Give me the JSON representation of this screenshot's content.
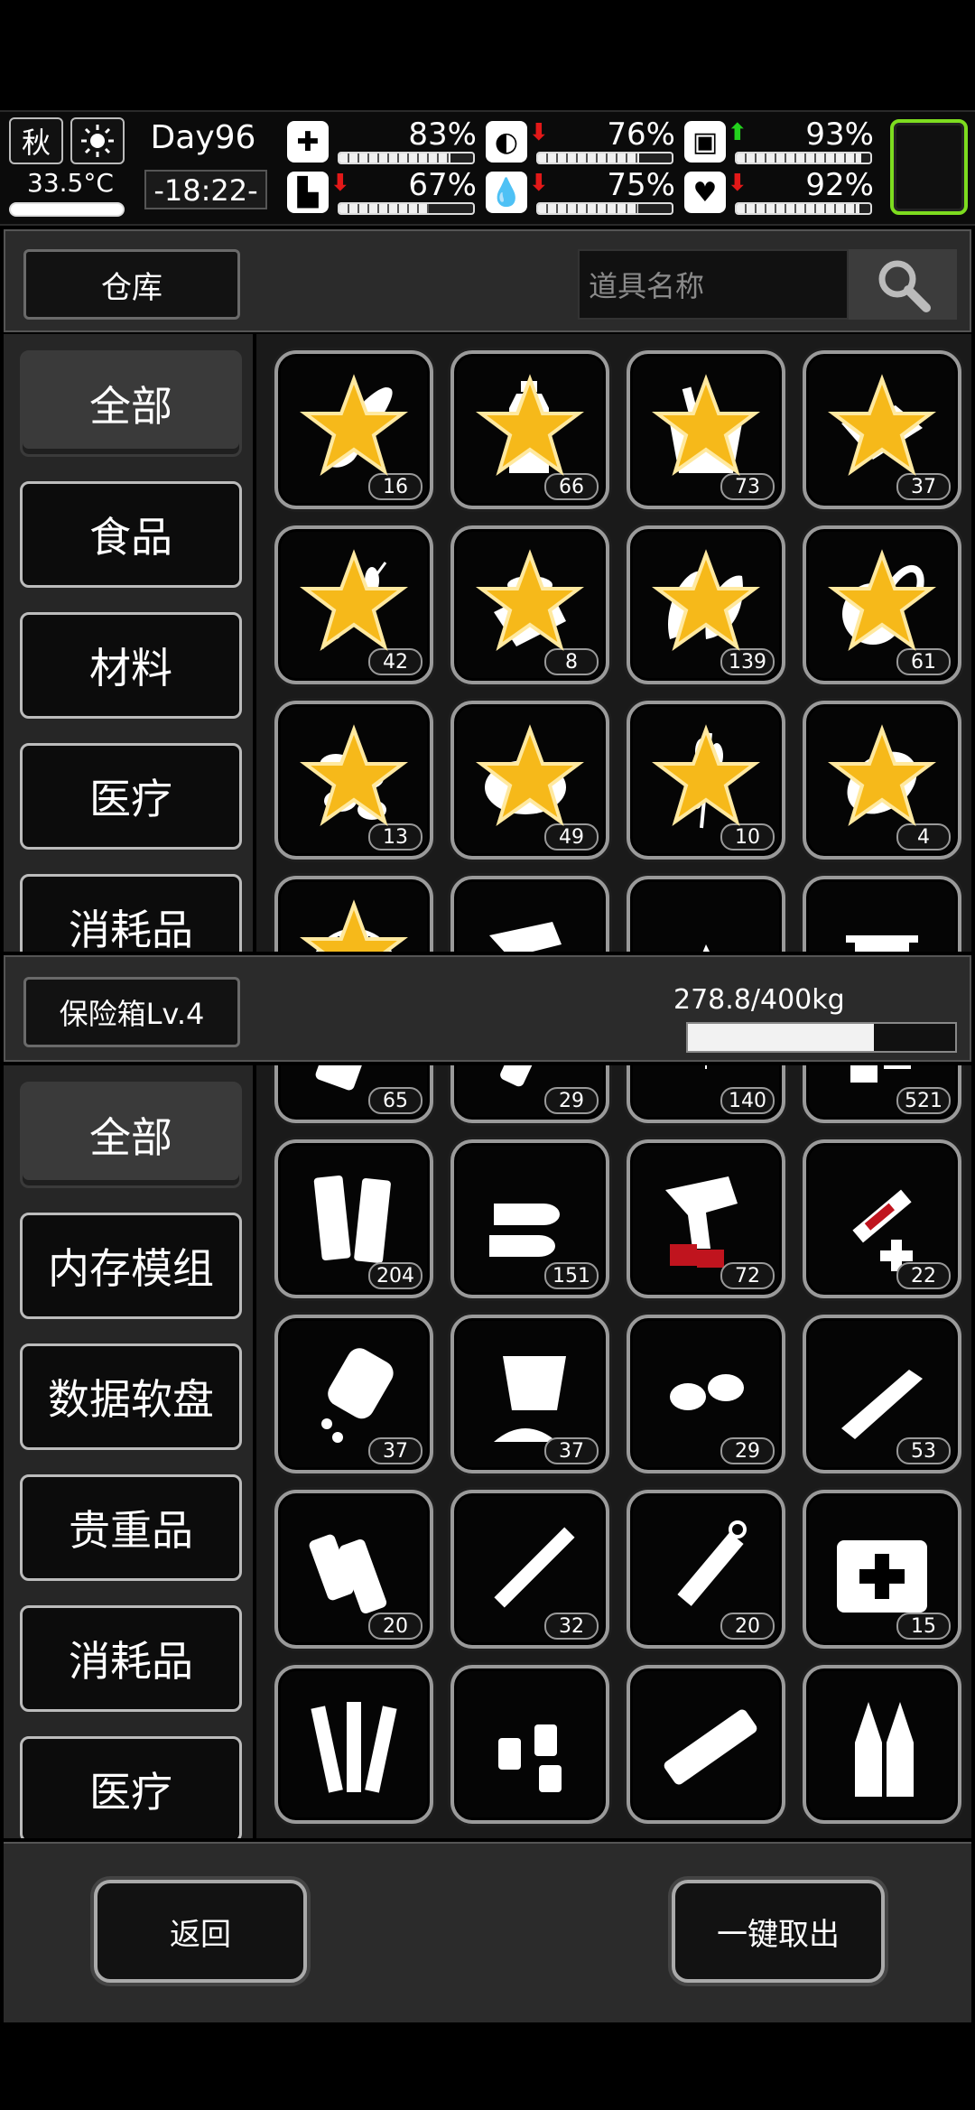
{
  "status": {
    "season": "秋",
    "temperature": "33.5°C",
    "day": "Day96",
    "time": "-18:22-",
    "stats": [
      {
        "name": "health",
        "percent": "83%",
        "fill": 0.83,
        "arrow": ""
      },
      {
        "name": "hunger",
        "percent": "76%",
        "fill": 0.76,
        "arrow": "down"
      },
      {
        "name": "stamina",
        "percent": "93%",
        "fill": 0.93,
        "arrow": "up"
      },
      {
        "name": "legs",
        "percent": "67%",
        "fill": 0.67,
        "arrow": "down"
      },
      {
        "name": "thirst",
        "percent": "75%",
        "fill": 0.75,
        "arrow": "down"
      },
      {
        "name": "mood",
        "percent": "92%",
        "fill": 0.92,
        "arrow": "down"
      }
    ]
  },
  "warehouse": {
    "title": "仓库",
    "search_placeholder": "道具名称",
    "categories": [
      "全部",
      "食品",
      "材料",
      "医疗",
      "消耗品"
    ],
    "items": [
      {
        "icon": "bread-icon",
        "count": "16",
        "star": true
      },
      {
        "icon": "water-bottle-icon",
        "count": "66",
        "star": true
      },
      {
        "icon": "bucket-icon",
        "count": "73",
        "star": true
      },
      {
        "icon": "tofu-icon",
        "count": "37",
        "star": true
      },
      {
        "icon": "skewer-icon",
        "count": "42",
        "star": true
      },
      {
        "icon": "canned-fish-icon",
        "count": "8",
        "star": true
      },
      {
        "icon": "leaves-icon",
        "count": "139",
        "star": true
      },
      {
        "icon": "fruit-icon",
        "count": "61",
        "star": true
      },
      {
        "icon": "nuts-icon",
        "count": "13",
        "star": true
      },
      {
        "icon": "egg-icon",
        "count": "49",
        "star": true
      },
      {
        "icon": "wheat-icon",
        "count": "10",
        "star": true
      },
      {
        "icon": "potato-icon",
        "count": "4",
        "star": true
      },
      {
        "icon": "net-icon",
        "count": "",
        "star": true
      },
      {
        "icon": "flare-gun-icon",
        "count": "",
        "star": false
      },
      {
        "icon": "shard-icon",
        "count": "",
        "star": false
      },
      {
        "icon": "towel-icon",
        "count": "",
        "star": false
      }
    ]
  },
  "safe": {
    "title": "保险箱Lv.4",
    "weight": "278.8/400kg",
    "weight_fill": 0.697,
    "categories": [
      "全部",
      "内存模组",
      "数据软盘",
      "贵重品",
      "消耗品",
      "医疗"
    ],
    "items": [
      {
        "icon": "tape-icon",
        "count": "65"
      },
      {
        "icon": "flashlight-icon",
        "count": "29"
      },
      {
        "icon": "net-trap-icon",
        "count": "140"
      },
      {
        "icon": "battery-icon",
        "count": "521"
      },
      {
        "icon": "bandage-rolls-icon",
        "count": "204"
      },
      {
        "icon": "bullets-icon",
        "count": "151"
      },
      {
        "icon": "flare-gun-ammo-icon",
        "count": "72"
      },
      {
        "icon": "syringe-icon",
        "count": "22"
      },
      {
        "icon": "pill-bottle-icon",
        "count": "37"
      },
      {
        "icon": "powder-icon",
        "count": "37"
      },
      {
        "icon": "seeds-icon",
        "count": "29"
      },
      {
        "icon": "ointment-icon",
        "count": "53"
      },
      {
        "icon": "gauze-icon",
        "count": "20"
      },
      {
        "icon": "cigarette-icon",
        "count": "32"
      },
      {
        "icon": "injector-icon",
        "count": "20"
      },
      {
        "icon": "first-aid-kit-icon",
        "count": "15"
      },
      {
        "icon": "tubes-icon",
        "count": ""
      },
      {
        "icon": "vials-icon",
        "count": ""
      },
      {
        "icon": "medical-battery-icon",
        "count": ""
      },
      {
        "icon": "ampoules-icon",
        "count": ""
      }
    ]
  },
  "footer": {
    "back_label": "返回",
    "take_all_label": "一键取出"
  }
}
